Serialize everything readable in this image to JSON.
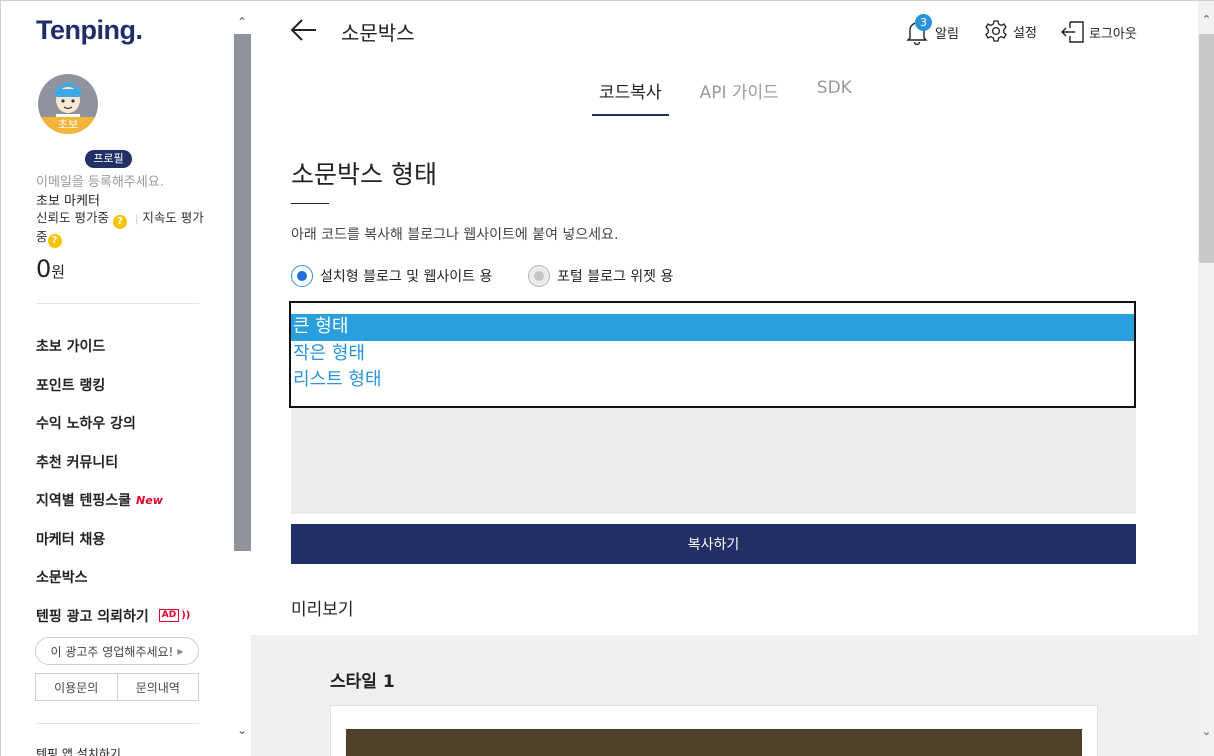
{
  "sidebar": {
    "logo": "Tenping.",
    "avatar_level": "초보",
    "profile_badge": "프로필",
    "email_hint": "이메일을 등록해주세요.",
    "user_title": "초보 마케터",
    "trust_label": "신뢰도 평가중",
    "duration_label": "지속도 평가",
    "duration_suffix": "중",
    "help_glyph": "?",
    "separator": "|",
    "points_value": "0",
    "points_unit": "원",
    "menu": [
      {
        "label": "초보 가이드"
      },
      {
        "label": "포인트 랭킹"
      },
      {
        "label": "수익 노하우 강의"
      },
      {
        "label": "추천 커뮤니티"
      },
      {
        "label": "지역별 텐핑스쿨",
        "tag": "New"
      },
      {
        "label": "마케터 채용"
      },
      {
        "label": "소문박스"
      },
      {
        "label": "텐핑 광고 의뢰하기",
        "tag": "AD"
      }
    ],
    "ad_wave": "))",
    "pill_button": "이 광고주 영업해주세요!",
    "pill_icon": "▶",
    "inquiry_button": "이용문의",
    "history_button": "문의내역",
    "app_install": "텐핑 앱 설치하기",
    "scroll_up": "⌃",
    "scroll_down": "⌄"
  },
  "header": {
    "title": "소문박스",
    "notification_count": "3",
    "notification_label": "알림",
    "settings_label": "설정",
    "logout_label": "로그아웃"
  },
  "tabs": [
    {
      "label": "코드복사",
      "active": true
    },
    {
      "label": "API 가이드",
      "active": false
    },
    {
      "label": "SDK",
      "active": false
    }
  ],
  "main": {
    "section_title": "소문박스 형태",
    "description": "아래 코드를 복사해 블로그나 웹사이트에 붙여 넣으세요.",
    "radio_install": "설치형 블로그 및 웹사이트 용",
    "radio_portal": "포털 블로그 위젯 용",
    "options": [
      "큰 형태",
      "작은 형태",
      "리스트 형태"
    ],
    "selected_option": "큰 형태",
    "copy_button": "복사하기",
    "preview_label": "미리보기",
    "style_title": "스타일 1"
  },
  "colors": {
    "brand_navy": "#233067",
    "accent_blue": "#2a93dc",
    "selection_blue": "#2a9fde",
    "alert_red": "#e4002b",
    "help_yellow": "#f5c400"
  }
}
